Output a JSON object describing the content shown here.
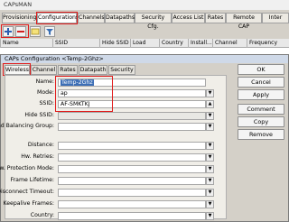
{
  "window": {
    "title": "CAPsMAN"
  },
  "outer_tabs": [
    "Provisioning",
    "Configurations",
    "Channels",
    "Datapaths",
    "Security Cfg.",
    "Access List",
    "Rates",
    "Remote CAP",
    "Inter"
  ],
  "columns": [
    "Name",
    "SSID",
    "Hide SSID",
    "Load Bal...",
    "Country",
    "Install...",
    "Channel",
    "Frequency"
  ],
  "dialog": {
    "title": "CAPs Configuration <Temp-2Ghz>"
  },
  "inner_tabs": [
    "Wireless",
    "Channel",
    "Rates",
    "Datapath",
    "Security"
  ],
  "form": {
    "name_label": "Name:",
    "name_value": "Temp-2Ghz",
    "mode_label": "Mode:",
    "mode_value": "ap",
    "ssid_label": "SSID:",
    "ssid_value": "AF-SMKTKJ",
    "hide_ssid_label": "Hide SSID:",
    "load_balancing_label": "Load Balancing Group:",
    "distance_label": "Distance:",
    "hw_retries_label": "Hw. Retries:",
    "hw_protection_label": "Hw. Protection Mode:",
    "frame_lifetime_label": "Frame Lifetime:",
    "disconnect_timeout_label": "Disconnect Timeout:",
    "keepalive_label": "Keepalive Frames:",
    "country_label": "Country:"
  },
  "buttons": {
    "ok": "OK",
    "cancel": "Cancel",
    "apply": "Apply",
    "comment": "Comment",
    "copy": "Copy",
    "remove": "Remove"
  },
  "colors": {
    "highlight": "#e01b1b",
    "selection": "#3d6fb6"
  }
}
